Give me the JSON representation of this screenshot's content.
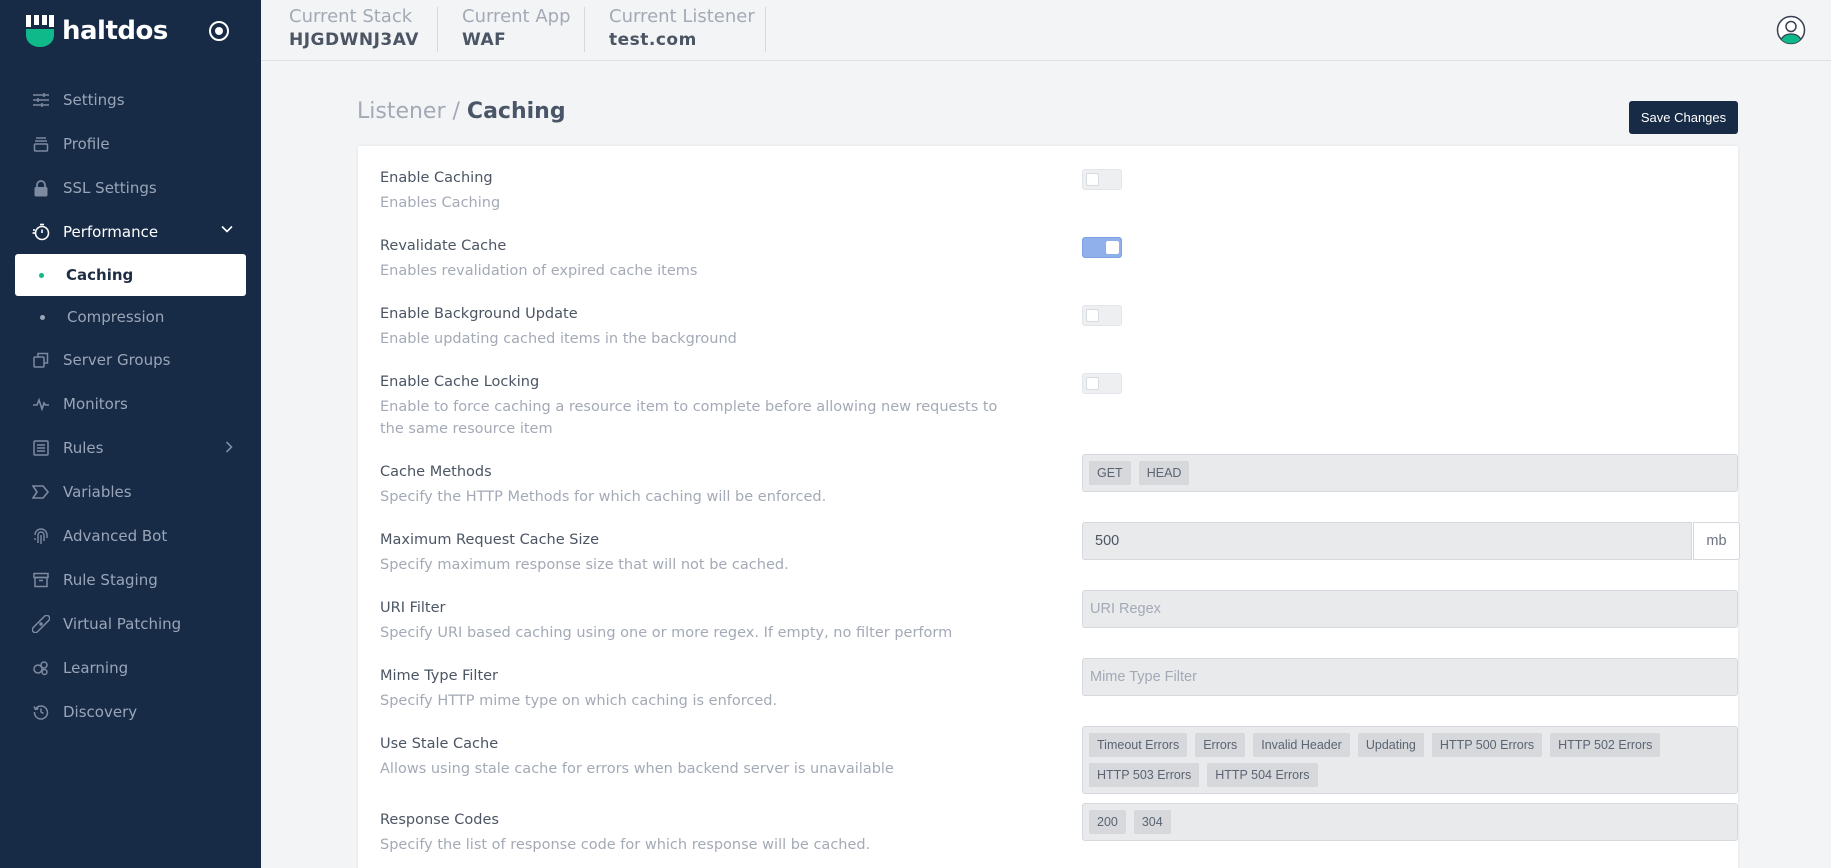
{
  "brand": {
    "name": "haltdos",
    "logo_icon": "haltdos-logo-icon",
    "accent": "#10b98a"
  },
  "header": {
    "contexts": [
      {
        "label": "Current Stack",
        "value": "HJGDWNJ3AV"
      },
      {
        "label": "Current App",
        "value": "WAF"
      },
      {
        "label": "Current Listener",
        "value": "test.com"
      }
    ]
  },
  "sidebar": {
    "items": [
      {
        "label": "Settings",
        "icon": "sliders-icon"
      },
      {
        "label": "Profile",
        "icon": "layers-icon"
      },
      {
        "label": "SSL Settings",
        "icon": "lock-icon"
      },
      {
        "label": "Performance",
        "icon": "stopwatch-icon",
        "expanded": true
      },
      {
        "label": "Caching",
        "sub": true,
        "active": true
      },
      {
        "label": "Compression",
        "sub": true
      },
      {
        "label": "Server Groups",
        "icon": "copy-icon"
      },
      {
        "label": "Monitors",
        "icon": "pulse-icon"
      },
      {
        "label": "Rules",
        "icon": "list-icon"
      },
      {
        "label": "Variables",
        "icon": "tag-icon"
      },
      {
        "label": "Advanced Bot",
        "icon": "fingerprint-icon"
      },
      {
        "label": "Rule Staging",
        "icon": "archive-icon"
      },
      {
        "label": "Virtual Patching",
        "icon": "bandage-icon"
      },
      {
        "label": "Learning",
        "icon": "circles-icon"
      },
      {
        "label": "Discovery",
        "icon": "history-icon"
      }
    ]
  },
  "breadcrumb": {
    "parent": "Listener",
    "separator": " / ",
    "current": "Caching"
  },
  "toolbar": {
    "save_label": "Save Changes"
  },
  "settings": {
    "enable_caching": {
      "label": "Enable Caching",
      "desc": "Enables Caching",
      "on": false
    },
    "revalidate_cache": {
      "label": "Revalidate Cache",
      "desc": "Enables revalidation of expired cache items",
      "on": true
    },
    "background_update": {
      "label": "Enable Background Update",
      "desc": "Enable updating cached items in the background",
      "on": false
    },
    "cache_locking": {
      "label": "Enable Cache Locking",
      "desc": "Enable to force caching a resource item to complete before allowing new requests to the same resource item",
      "on": false
    },
    "cache_methods": {
      "label": "Cache Methods",
      "desc": "Specify the HTTP Methods for which caching will be enforced.",
      "tags": [
        "GET",
        "HEAD"
      ]
    },
    "max_cache_size": {
      "label": "Maximum Request Cache Size",
      "desc": "Specify maximum response size that will not be cached.",
      "value": "500",
      "unit": "mb"
    },
    "uri_filter": {
      "label": "URI Filter",
      "desc": "Specify URI based caching using one or more regex. If empty, no filter perform",
      "placeholder": "URI Regex"
    },
    "mime_filter": {
      "label": "Mime Type Filter",
      "desc": "Specify HTTP mime type on which caching is enforced.",
      "placeholder": "Mime Type Filter"
    },
    "stale_cache": {
      "label": "Use Stale Cache",
      "desc": "Allows using stale cache for errors when backend server is unavailable",
      "tags": [
        "Timeout Errors",
        "Errors",
        "Invalid Header",
        "Updating",
        "HTTP 500 Errors",
        "HTTP 502 Errors",
        "HTTP 503 Errors",
        "HTTP 504 Errors"
      ]
    },
    "response_codes": {
      "label": "Response Codes",
      "desc": "Specify the list of response code for which response will be cached.",
      "tags": [
        "200",
        "304"
      ]
    }
  }
}
